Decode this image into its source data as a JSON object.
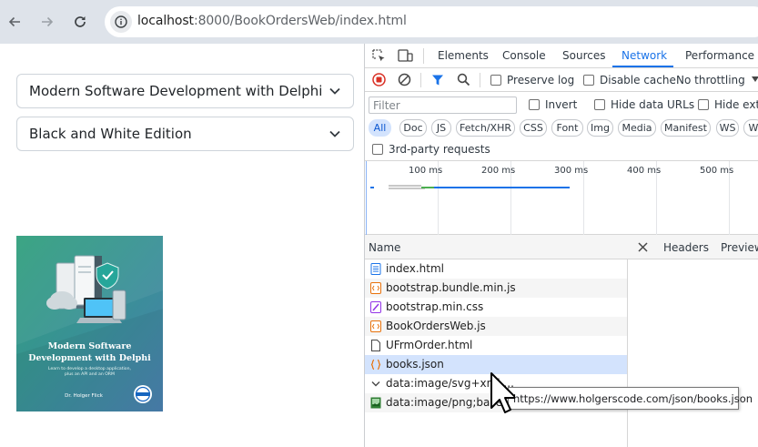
{
  "browser": {
    "url_host": "localhost",
    "url_path": ":8000/BookOrdersWeb/index.html"
  },
  "page": {
    "select_book": "Modern Software Development with Delphi",
    "select_edition": "Black and White Edition",
    "cover": {
      "title_line1": "Modern Software",
      "title_line2": "Development with Delphi",
      "subtitle_line1": "Learn to develop a desktop application,",
      "subtitle_line2": "plus an API and an ORM",
      "author": "Dr. Holger Flick",
      "colors": {
        "top": "#2e9e7e",
        "bottom": "#3f7fa8"
      }
    }
  },
  "devtools": {
    "tabs": [
      "Elements",
      "Console",
      "Sources",
      "Network",
      "Performance"
    ],
    "active_tab": "Network",
    "toolbar": {
      "preserve_log": "Preserve log",
      "disable_cache": "Disable cache",
      "throttling": "No throttling"
    },
    "filter": {
      "placeholder": "Filter",
      "invert": "Invert",
      "hide_data_urls": "Hide data URLs",
      "hide_ext": "Hide exte"
    },
    "type_chips": [
      "All",
      "Doc",
      "JS",
      "Fetch/XHR",
      "CSS",
      "Font",
      "Img",
      "Media",
      "Manifest",
      "WS",
      "W"
    ],
    "third_party": "3rd-party requests",
    "timeline_ticks": [
      "100 ms",
      "200 ms",
      "300 ms",
      "400 ms",
      "500 ms"
    ],
    "column_name": "Name",
    "detail_tabs": [
      "Headers",
      "Preview"
    ],
    "requests": [
      {
        "name": "index.html",
        "type": "doc"
      },
      {
        "name": "bootstrap.bundle.min.js",
        "type": "js"
      },
      {
        "name": "bootstrap.min.css",
        "type": "css"
      },
      {
        "name": "BookOrdersWeb.js",
        "type": "js"
      },
      {
        "name": "UFrmOrder.html",
        "type": "file"
      },
      {
        "name": "books.json",
        "type": "json"
      },
      {
        "name": "data:image/svg+xml,...",
        "type": "svg"
      },
      {
        "name": "data:image/png;base...",
        "type": "img"
      }
    ],
    "selected_request": "books.json",
    "tooltip": "https://www.holgerscode.com/json/books.json"
  }
}
